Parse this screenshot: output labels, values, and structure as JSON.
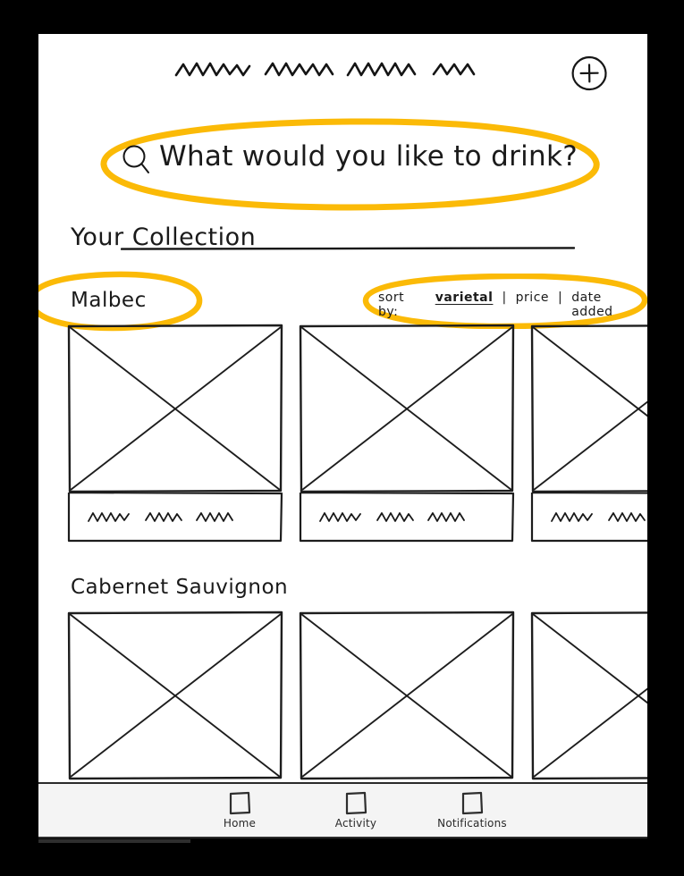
{
  "theme": {
    "highlight_color": "#FBBA07",
    "ink_color": "#1a1a1a",
    "nav_bg": "#f4f4f4",
    "canvas_bg": "#ffffff",
    "backdrop": "#000000"
  },
  "topbar": {
    "title_placeholder": "squiggle-title-placeholder",
    "add_button_label": "+",
    "add_button_icon": "plus-circle-icon"
  },
  "search": {
    "icon": "search-icon",
    "placeholder": "What would you like to drink?",
    "value": "",
    "highlighted": true
  },
  "main": {
    "collection_title": "Your Collection",
    "sort": {
      "label": "sort by:",
      "options": [
        {
          "label": "varietal",
          "active": true
        },
        {
          "label": "price",
          "active": false
        },
        {
          "label": "date added",
          "active": false
        }
      ],
      "divider": "|",
      "highlighted": true
    },
    "sections": [
      {
        "title": "Malbec",
        "highlighted": true,
        "cards": [
          {
            "thumb": "image-placeholder",
            "caption": "squiggle-caption-placeholder",
            "caption_words": 3
          },
          {
            "thumb": "image-placeholder",
            "caption": "squiggle-caption-placeholder",
            "caption_words": 3
          },
          {
            "thumb": "image-placeholder",
            "caption": "squiggle-caption-placeholder",
            "caption_words": 2
          }
        ]
      },
      {
        "title": "Cabernet Sauvignon",
        "highlighted": false,
        "cards": [
          {
            "thumb": "image-placeholder",
            "caption": "",
            "caption_words": 0
          },
          {
            "thumb": "image-placeholder",
            "caption": "",
            "caption_words": 0
          },
          {
            "thumb": "image-placeholder",
            "caption": "",
            "caption_words": 0
          }
        ]
      }
    ]
  },
  "bottom_nav": {
    "items": [
      {
        "label": "Home",
        "icon": "square-icon",
        "active": true
      },
      {
        "label": "Activity",
        "icon": "square-icon",
        "active": false
      },
      {
        "label": "Notifications",
        "icon": "square-icon",
        "active": false
      }
    ]
  }
}
